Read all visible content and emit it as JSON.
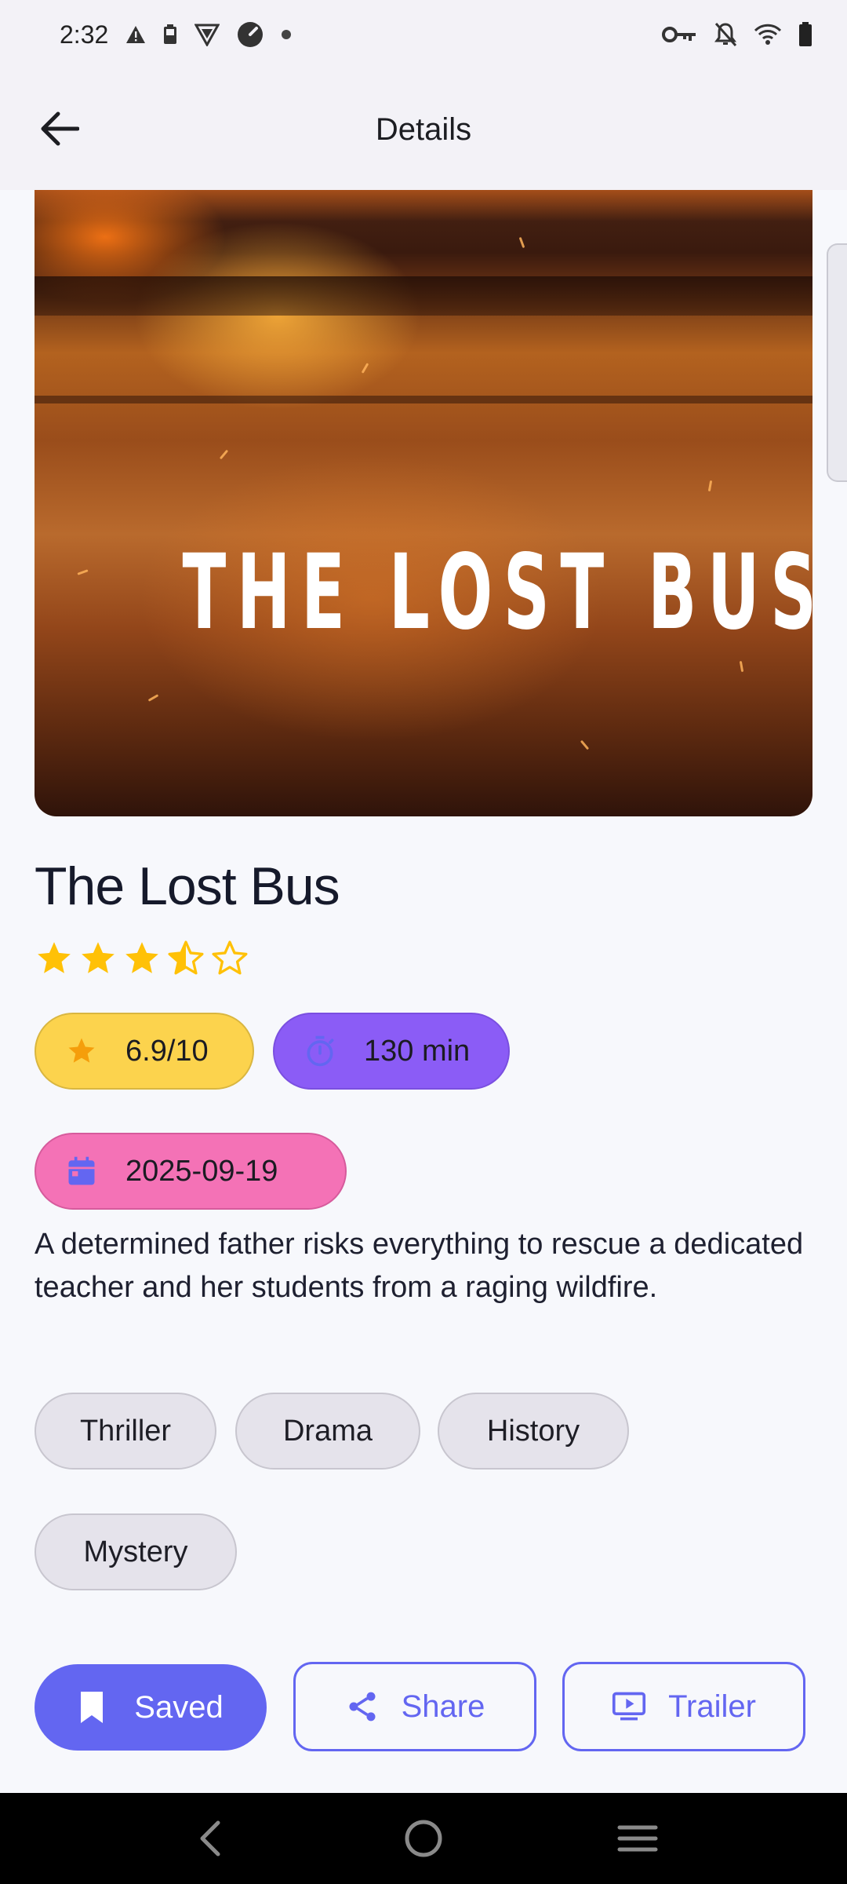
{
  "status_bar": {
    "time": "2:32",
    "left_icons": [
      "warning-icon",
      "battery-saver-icon",
      "vpn-shield-icon",
      "speedometer-icon",
      "dot-icon"
    ],
    "right_icons": [
      "key-icon",
      "notifications-off-icon",
      "wifi-icon",
      "battery-icon"
    ]
  },
  "app_bar": {
    "title": "Details",
    "back_icon": "arrow-back-icon"
  },
  "poster": {
    "title_text": "THE LOST BUS"
  },
  "movie": {
    "title": "The Lost Bus",
    "star_rating": 3.5,
    "star_max": 5,
    "rating_label": "6.9/10",
    "runtime_label": "130 min",
    "release_date": "2025-09-19",
    "overview": "A determined father risks everything to rescue a dedicated teacher and her students from a raging wildfire.",
    "genres": [
      "Thriller",
      "Drama",
      "History",
      "Mystery"
    ]
  },
  "actions": {
    "saved_label": "Saved",
    "share_label": "Share",
    "trailer_label": "Trailer"
  },
  "colors": {
    "accent": "#6366F1",
    "rating_chip": "#FCD34D",
    "runtime_chip": "#8B5CF6",
    "date_chip": "#F472B6",
    "star": "#FFC107",
    "genre_chip": "#E5E3EB"
  },
  "nav_bar": {
    "icons": [
      "nav-back-icon",
      "nav-home-icon",
      "nav-menu-icon"
    ]
  }
}
